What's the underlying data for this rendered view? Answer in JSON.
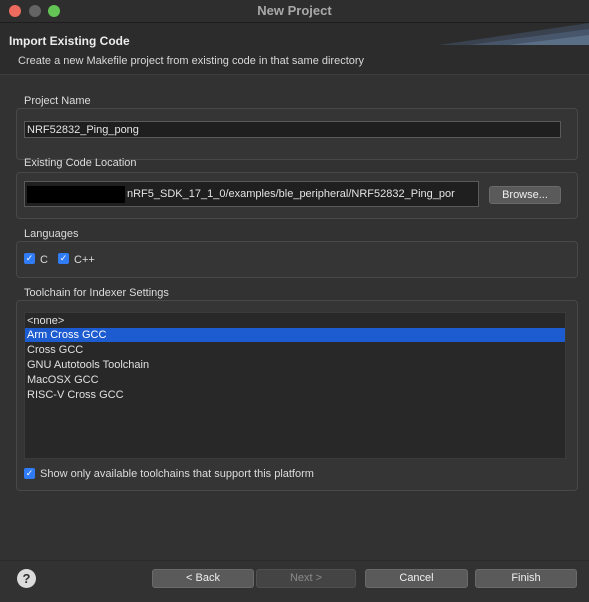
{
  "window": {
    "title": "New Project"
  },
  "header": {
    "heading": "Import Existing Code",
    "description": "Create a new Makefile project from existing code in that same directory"
  },
  "project_name": {
    "label": "Project Name",
    "value": "NRF52832_Ping_pong"
  },
  "code_location": {
    "label": "Existing Code Location",
    "value": "nRF5_SDK_17_1_0/examples/ble_peripheral/NRF52832_Ping_por",
    "browse_label": "Browse..."
  },
  "languages": {
    "label": "Languages",
    "items": [
      {
        "label": "C",
        "checked": true
      },
      {
        "label": "C++",
        "checked": true
      }
    ]
  },
  "toolchain": {
    "label": "Toolchain for Indexer Settings",
    "items": [
      {
        "label": "<none>"
      },
      {
        "label": "Arm Cross GCC",
        "selected": true
      },
      {
        "label": "Cross GCC"
      },
      {
        "label": "GNU Autotools Toolchain"
      },
      {
        "label": "MacOSX GCC"
      },
      {
        "label": "RISC-V Cross GCC"
      }
    ],
    "filter_label": "Show only available toolchains that support this platform",
    "filter_checked": true
  },
  "footer": {
    "back_label": "< Back",
    "next_label": "Next >",
    "cancel_label": "Cancel",
    "finish_label": "Finish"
  },
  "colors": {
    "accent": "#2f7cf6",
    "selection": "#1c5bd0"
  }
}
